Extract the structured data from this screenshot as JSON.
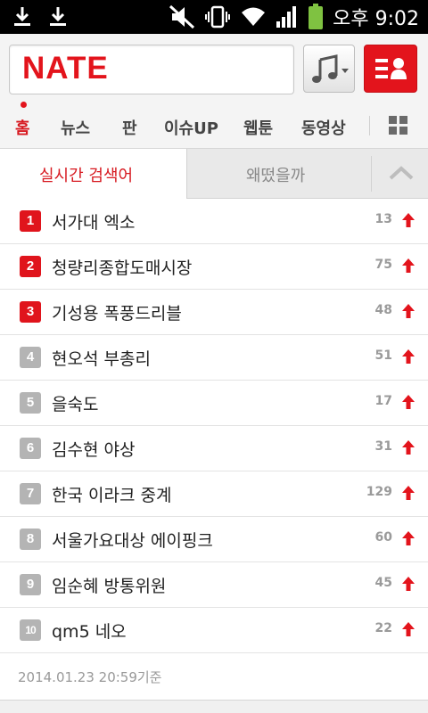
{
  "status_bar": {
    "time": "오후 9:02",
    "icons": [
      "download-icon",
      "download-icon",
      "mute-icon",
      "vibrate-icon",
      "wifi-icon",
      "signal-icon",
      "battery-icon"
    ]
  },
  "header": {
    "logo": "NATE",
    "music_icon": "music-note-icon",
    "menu_icon": "profile-list-icon",
    "accent_color": "#e3141c"
  },
  "nav": {
    "items": [
      {
        "label": "홈",
        "active": true
      },
      {
        "label": "뉴스"
      },
      {
        "label": "판"
      },
      {
        "label": "이슈UP"
      },
      {
        "label": "웹툰"
      },
      {
        "label": "동영상"
      }
    ],
    "grid_icon": "grid-icon"
  },
  "tabs": {
    "active": "실시간 검색어",
    "inactive": "왜떴을까",
    "collapse_icon": "chevron-up-icon"
  },
  "ranking": [
    {
      "rank": "1",
      "keyword": "서가대 엑소",
      "count": "13"
    },
    {
      "rank": "2",
      "keyword": "청량리종합도매시장",
      "count": "75"
    },
    {
      "rank": "3",
      "keyword": "기성용 폭풍드리블",
      "count": "48"
    },
    {
      "rank": "4",
      "keyword": "현오석 부총리",
      "count": "51"
    },
    {
      "rank": "5",
      "keyword": "을숙도",
      "count": "17"
    },
    {
      "rank": "6",
      "keyword": "김수현 야상",
      "count": "31"
    },
    {
      "rank": "7",
      "keyword": "한국 이라크 중계",
      "count": "129"
    },
    {
      "rank": "8",
      "keyword": "서울가요대상 에이핑크",
      "count": "60"
    },
    {
      "rank": "9",
      "keyword": "임순혜 방통위원",
      "count": "45"
    },
    {
      "rank": "10",
      "keyword": "qm5 네오",
      "count": "22"
    }
  ],
  "footer": {
    "timestamp": "2014.01.23 20:59기준"
  }
}
